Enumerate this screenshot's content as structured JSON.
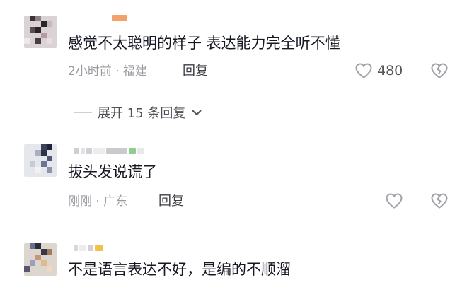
{
  "comments": [
    {
      "text": "感觉不太聪明的样子  表达能力完全听不懂",
      "meta": "2小时前 · 福建",
      "reply_label": "回复",
      "like_count": "480"
    },
    {
      "text": "拔头发说谎了",
      "meta": "刚刚 · 广东",
      "reply_label": "回复",
      "like_count": ""
    },
    {
      "text": "不是语言表达不好，是编的不顺溜"
    }
  ],
  "expand_replies": {
    "label": "展开 15 条回复"
  },
  "colors": {
    "text_primary": "#161823",
    "text_meta": "#9a9aa0",
    "icon_gray": "#a0a0a6"
  },
  "icons": {
    "like": "heart-outline-icon",
    "dislike": "broken-heart-icon",
    "expand": "chevron-down-icon"
  }
}
